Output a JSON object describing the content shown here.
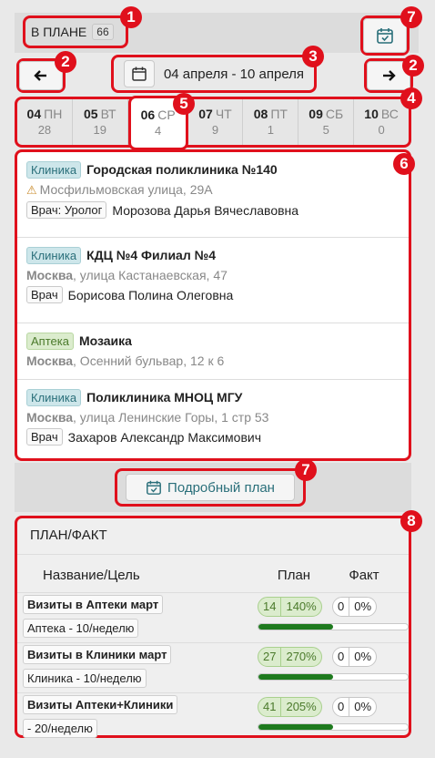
{
  "header": {
    "in_plan_label": "В ПЛАНЕ",
    "in_plan_count": "66"
  },
  "nav": {
    "date_range": "04 апреля - 10 апреля",
    "prev_icon": "arrow-left-icon",
    "next_icon": "arrow-right-icon",
    "calendar_icon": "calendar-icon",
    "calendar_check_icon": "calendar-check-icon"
  },
  "days": [
    {
      "num": "04",
      "name": "ПН",
      "count": "28"
    },
    {
      "num": "05",
      "name": "ВТ",
      "count": "19"
    },
    {
      "num": "06",
      "name": "СР",
      "count": "4"
    },
    {
      "num": "07",
      "name": "ЧТ",
      "count": "9"
    },
    {
      "num": "08",
      "name": "ПТ",
      "count": "1"
    },
    {
      "num": "09",
      "name": "СБ",
      "count": "5"
    },
    {
      "num": "10",
      "name": "ВС",
      "count": "0"
    }
  ],
  "visits": [
    {
      "type": "Клиника",
      "title": "Городская поликлиника №140",
      "city": "",
      "address": "Мосфильмовская улица, 29А",
      "warning": true,
      "doctor_label": "Врач: Уролог",
      "doctor_name": "Морозова Дарья Вячеславовна"
    },
    {
      "type": "Клиника",
      "title": "КДЦ №4 Филиал №4",
      "city": "Москва",
      "address": ", улица Кастанаевская, 47",
      "warning": false,
      "doctor_label": "Врач",
      "doctor_name": "Борисова Полина Олеговна"
    },
    {
      "type": "Аптека",
      "title": "Мозаика",
      "city": "Москва",
      "address": ", Осенний бульвар, 12 к 6",
      "warning": false,
      "doctor_label": "",
      "doctor_name": ""
    },
    {
      "type": "Клиника",
      "title": "Поликлиника МНОЦ МГУ",
      "city": "Москва",
      "address": ", улица Ленинские Горы, 1 стр 53",
      "warning": false,
      "doctor_label": "Врач",
      "doctor_name": "Захаров Александр Максимович"
    }
  ],
  "detail_button": "Подробный план",
  "planfact": {
    "title": "ПЛАН/ФАКТ",
    "col_name": "Название/Цель",
    "col_plan": "План",
    "col_fact": "Факт",
    "rows": [
      {
        "name": "Визиты в Аптеки март",
        "target": "Аптека - 10/неделю",
        "plan": "14",
        "plan_pct": "140%",
        "fact": "0",
        "fact_pct": "0%",
        "progress": 0.5
      },
      {
        "name": "Визиты в Клиники март",
        "target": "Клиника - 10/неделю",
        "plan": "27",
        "plan_pct": "270%",
        "fact": "0",
        "fact_pct": "0%",
        "progress": 0.5
      },
      {
        "name": "Визиты Аптеки+Клиники",
        "target": " - 20/неделю",
        "plan": "41",
        "plan_pct": "205%",
        "fact": "0",
        "fact_pct": "0%",
        "progress": 0.5
      }
    ]
  },
  "markers": [
    "1",
    "2",
    "2",
    "3",
    "4",
    "5",
    "6",
    "7",
    "7",
    "8"
  ],
  "colors": {
    "accent_red": "#e0101c",
    "clinic": "#cde6ea",
    "pharmacy": "#dbeccd",
    "progress": "#1e7a1e"
  }
}
